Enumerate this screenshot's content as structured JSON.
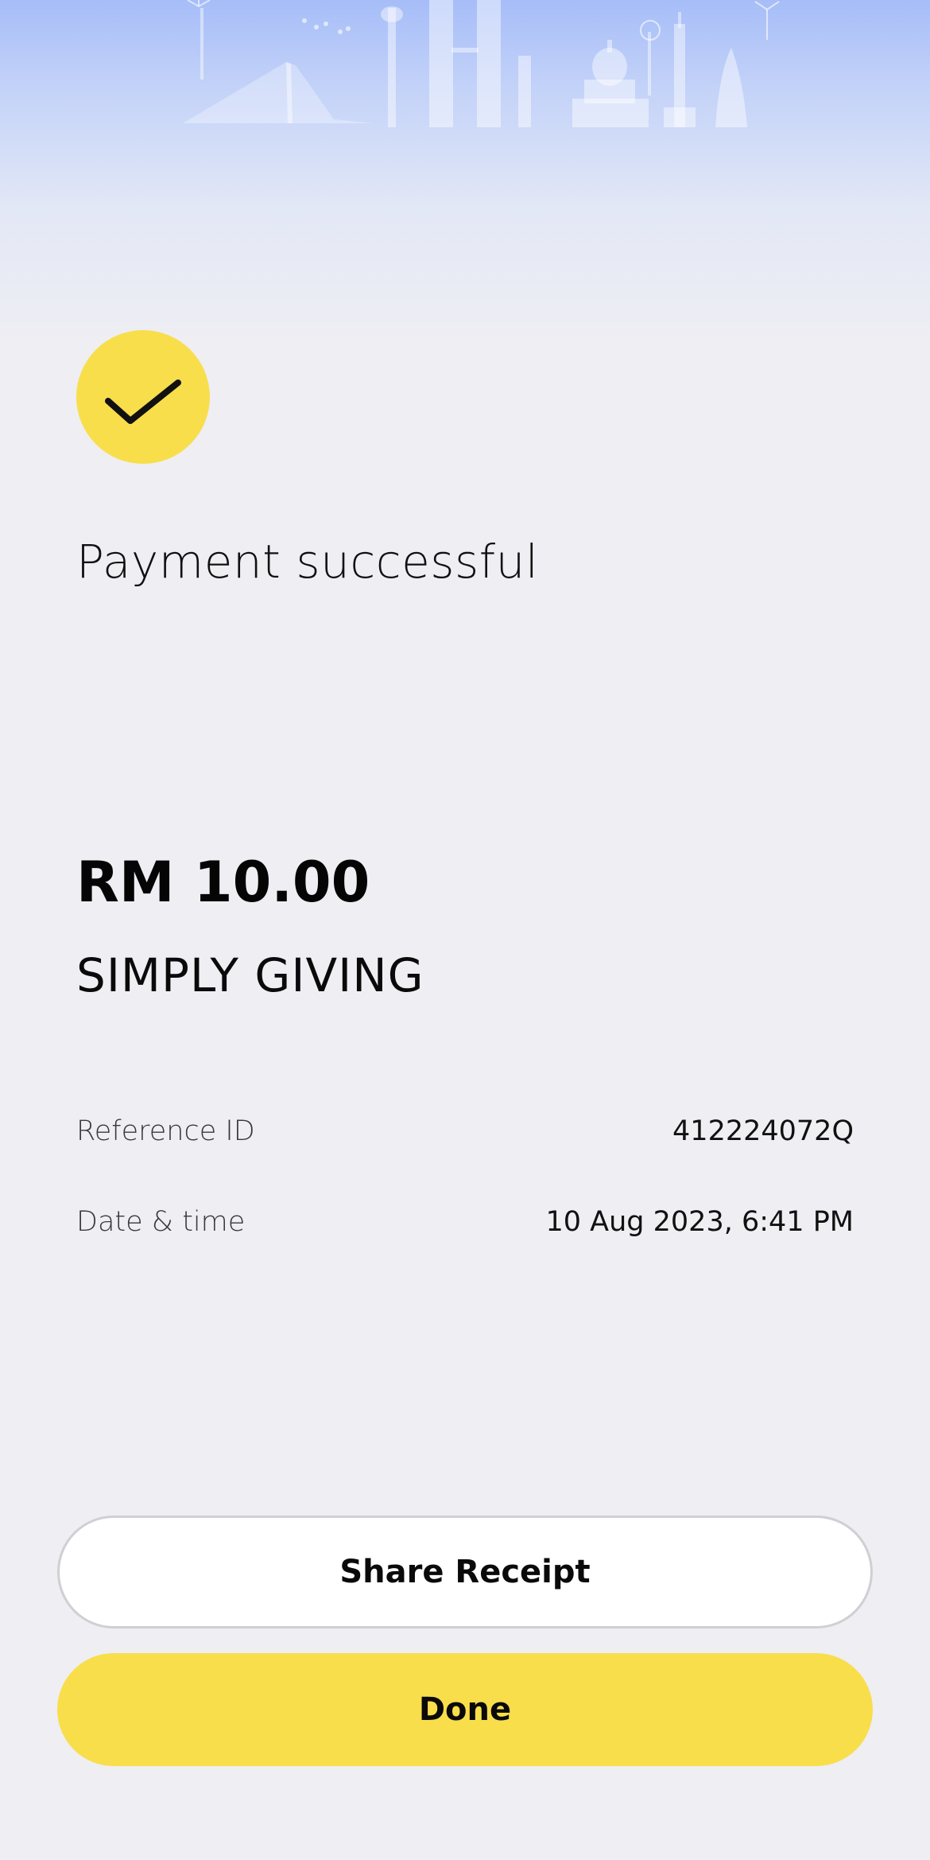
{
  "receipt": {
    "status_title": "Payment successful",
    "amount": "RM 10.00",
    "merchant": "SIMPLY GIVING",
    "details": [
      {
        "label": "Reference ID",
        "value": "412224072Q"
      },
      {
        "label": "Date & time",
        "value": "10 Aug 2023, 6:41 PM"
      }
    ]
  },
  "actions": {
    "share_label": "Share Receipt",
    "done_label": "Done"
  },
  "icons": {
    "status": "check-icon",
    "header": "city-skyline-illustration"
  },
  "colors": {
    "accent": "#f8de4b",
    "background": "#efeef3",
    "header_top": "#a6bdf8",
    "button_border": "#cfcfd4"
  }
}
